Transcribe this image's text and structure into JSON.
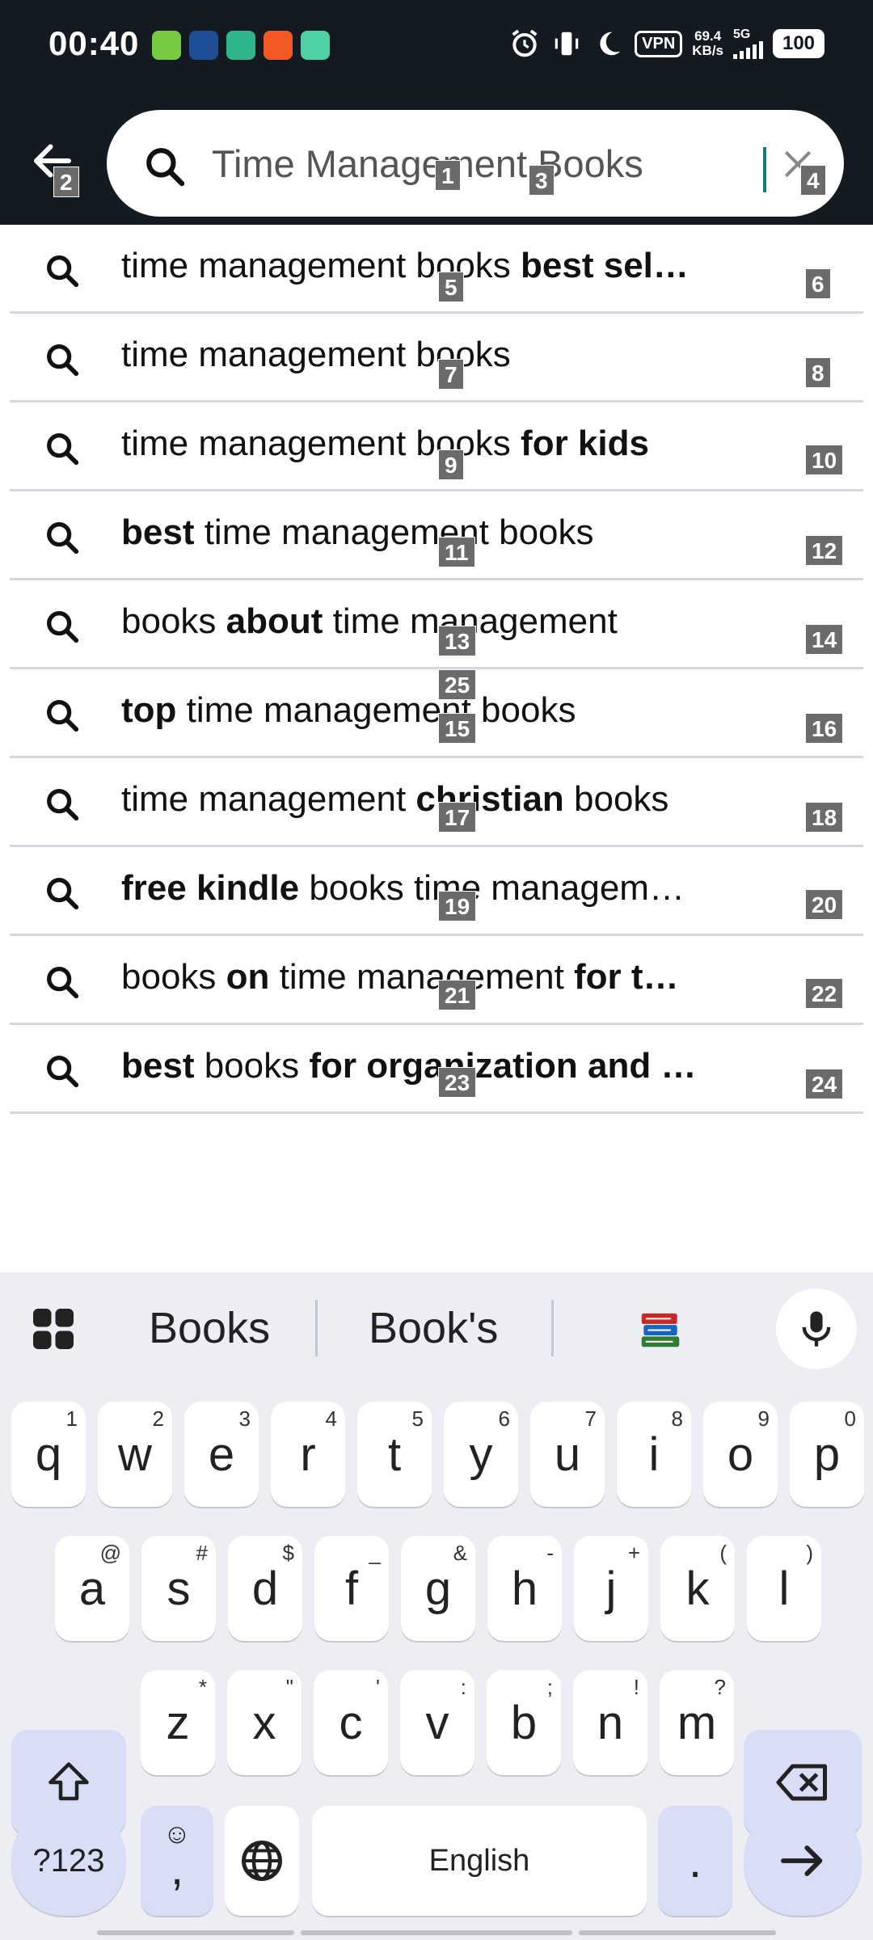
{
  "status_bar": {
    "time": "00:40",
    "vpn": "VPN",
    "speed_value": "69.4",
    "speed_unit": "KB/s",
    "network": "5G",
    "battery": "100"
  },
  "search": {
    "query": "Time Management Books",
    "colors": {
      "header_bg": "#131a22",
      "caret": "#0f7c7f"
    }
  },
  "suggestions": [
    {
      "parts": [
        {
          "t": "time management books ",
          "b": false
        },
        {
          "t": "best sel…",
          "b": true
        }
      ]
    },
    {
      "parts": [
        {
          "t": "time management books",
          "b": false
        }
      ]
    },
    {
      "parts": [
        {
          "t": "time management books ",
          "b": false
        },
        {
          "t": "for kids",
          "b": true
        }
      ]
    },
    {
      "parts": [
        {
          "t": "best",
          "b": true
        },
        {
          "t": " time management books",
          "b": false
        }
      ]
    },
    {
      "parts": [
        {
          "t": "books ",
          "b": false
        },
        {
          "t": "about",
          "b": true
        },
        {
          "t": " time management",
          "b": false
        }
      ]
    },
    {
      "parts": [
        {
          "t": "top",
          "b": true
        },
        {
          "t": " time management books",
          "b": false
        }
      ]
    },
    {
      "parts": [
        {
          "t": "time management ",
          "b": false
        },
        {
          "t": "christian",
          "b": true
        },
        {
          "t": " books",
          "b": false
        }
      ]
    },
    {
      "parts": [
        {
          "t": "free kindle",
          "b": true
        },
        {
          "t": " books time managem…",
          "b": false
        }
      ]
    },
    {
      "parts": [
        {
          "t": "books ",
          "b": false
        },
        {
          "t": "on",
          "b": true
        },
        {
          "t": " time management ",
          "b": false
        },
        {
          "t": "for t…",
          "b": true
        }
      ]
    },
    {
      "parts": [
        {
          "t": "best",
          "b": true
        },
        {
          "t": " books ",
          "b": false
        },
        {
          "t": "for organization and …",
          "b": true
        }
      ]
    }
  ],
  "overlay_tags": {
    "t1": "1",
    "t2": "2",
    "t3": "3",
    "t4": "4",
    "t5": "5",
    "t6": "6",
    "t7": "7",
    "t8": "8",
    "t9": "9",
    "t10": "10",
    "t11": "11",
    "t12": "12",
    "t13": "13",
    "t14": "14",
    "t15": "15",
    "t16": "16",
    "t17": "17",
    "t18": "18",
    "t19": "19",
    "t20": "20",
    "t21": "21",
    "t22": "22",
    "t23": "23",
    "t24": "24",
    "t25": "25"
  },
  "keyboard": {
    "suggestions": [
      "Books",
      "Book's"
    ],
    "row1": [
      {
        "k": "q",
        "h": "1"
      },
      {
        "k": "w",
        "h": "2"
      },
      {
        "k": "e",
        "h": "3"
      },
      {
        "k": "r",
        "h": "4"
      },
      {
        "k": "t",
        "h": "5"
      },
      {
        "k": "y",
        "h": "6"
      },
      {
        "k": "u",
        "h": "7"
      },
      {
        "k": "i",
        "h": "8"
      },
      {
        "k": "o",
        "h": "9"
      },
      {
        "k": "p",
        "h": "0"
      }
    ],
    "row2": [
      {
        "k": "a",
        "h": "@"
      },
      {
        "k": "s",
        "h": "#"
      },
      {
        "k": "d",
        "h": "$"
      },
      {
        "k": "f",
        "h": "_"
      },
      {
        "k": "g",
        "h": "&"
      },
      {
        "k": "h",
        "h": "-"
      },
      {
        "k": "j",
        "h": "+"
      },
      {
        "k": "k",
        "h": "("
      },
      {
        "k": "l",
        "h": ")"
      }
    ],
    "row3": [
      {
        "k": "z",
        "h": "*"
      },
      {
        "k": "x",
        "h": "\""
      },
      {
        "k": "c",
        "h": "'"
      },
      {
        "k": "v",
        "h": ":"
      },
      {
        "k": "b",
        "h": ";"
      },
      {
        "k": "n",
        "h": "!"
      },
      {
        "k": "m",
        "h": "?"
      }
    ],
    "symbols_label": "?123",
    "comma_label": ",",
    "space_label": "English",
    "period_label": ".",
    "colors": {
      "bg": "#eceef4",
      "func_key": "#d8def6"
    }
  }
}
